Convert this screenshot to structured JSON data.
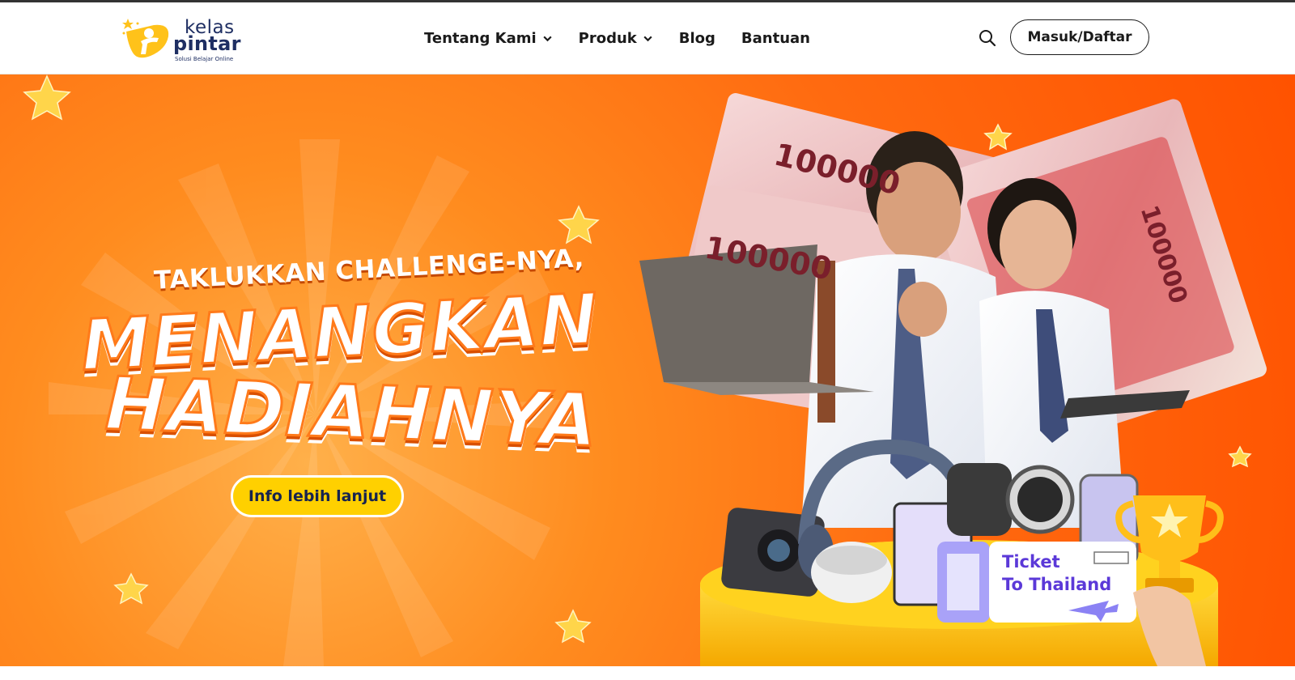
{
  "brand": {
    "logo_top": "kelas",
    "logo_main": "pintar",
    "logo_tagline": "Solusi Belajar Online"
  },
  "nav": {
    "items": [
      {
        "label": "Tentang Kami",
        "has_dropdown": true
      },
      {
        "label": "Produk",
        "has_dropdown": true
      },
      {
        "label": "Blog",
        "has_dropdown": false
      },
      {
        "label": "Bantuan",
        "has_dropdown": false
      }
    ],
    "search_icon": "search-icon",
    "login_label": "Masuk/Daftar"
  },
  "hero": {
    "headline_small": "TAKLUKKAN CHALLENGE-NYA,",
    "headline_line1": "MENANGKAN",
    "headline_line2": "HADIAHNYA",
    "cta_label": "Info lebih lanjut",
    "ticket_line1": "Ticket",
    "ticket_line2": "To Thailand",
    "banknote_value": "100000"
  },
  "colors": {
    "hero_orange": "#ff6a10",
    "cta_yellow": "#ffd000",
    "navy_text": "#17244f",
    "ticket_purple": "#5b39d8"
  }
}
